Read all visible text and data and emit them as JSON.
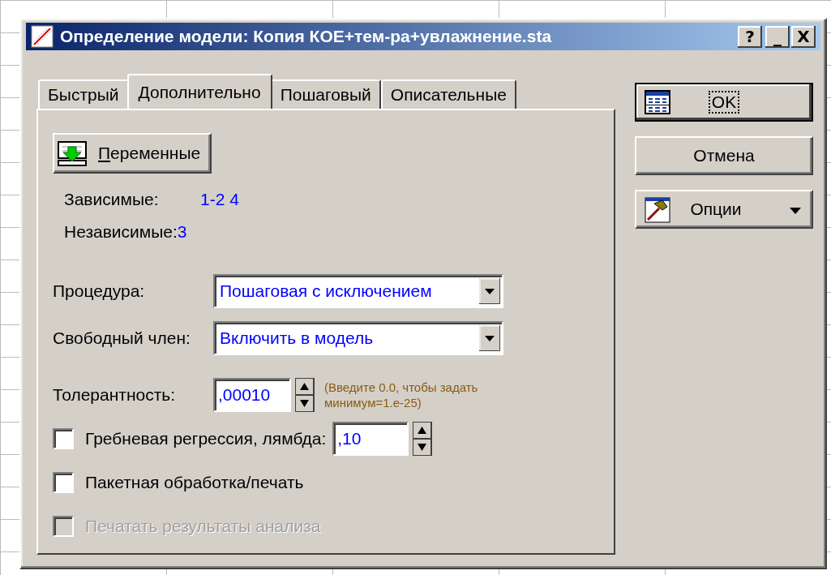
{
  "window": {
    "title": "Определение модели: Копия КОЕ+тем-ра+увлажнение.sta",
    "buttons": [
      {
        "kind": "help",
        "label": "?"
      },
      {
        "kind": "minimize",
        "label": "_"
      },
      {
        "kind": "close",
        "label": "X"
      }
    ]
  },
  "tabs": [
    {
      "label": "Быстрый",
      "selected": false
    },
    {
      "label": "Дополнительно",
      "selected": true
    },
    {
      "label": "Пошаговый",
      "selected": false
    },
    {
      "label": "Описательные",
      "selected": false
    }
  ],
  "variables_button": {
    "label": "Переменные"
  },
  "variables": [
    {
      "label": "Зависимые:",
      "value": "1-2 4"
    },
    {
      "label": "Независимые:",
      "value": "3"
    }
  ],
  "dropdowns": [
    {
      "label": "Процедура:",
      "value": "Пошаговая с исключением"
    },
    {
      "label": "Свободный член:",
      "value": "Включить в модель"
    }
  ],
  "tolerance": {
    "label": "Толерантность:",
    "value": ",00010",
    "hint": "(Введите 0.0, чтобы задать минимум=1.e-25)"
  },
  "options": [
    {
      "kind": "field",
      "label": "Гребневая регрессия, лямбда:",
      "checked": false,
      "disabled": false,
      "value": ",10"
    },
    {
      "kind": "plain",
      "label": "Пакетная обработка/печать",
      "checked": false,
      "disabled": false
    },
    {
      "kind": "plain",
      "label": "Печатать результаты анализа",
      "checked": false,
      "disabled": true
    }
  ],
  "buttons": [
    {
      "kind": "ok",
      "label": "OK",
      "default": true
    },
    {
      "kind": "cancel",
      "label": "Отмена",
      "default": false
    },
    {
      "kind": "options",
      "label": "Опции",
      "default": false
    }
  ]
}
